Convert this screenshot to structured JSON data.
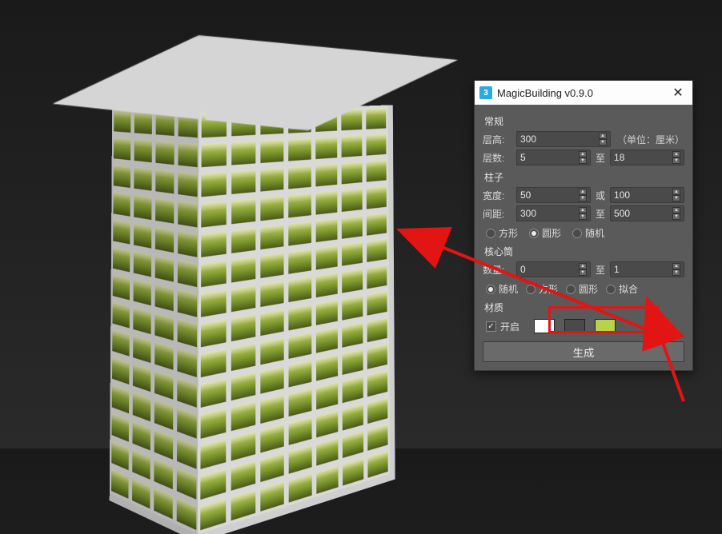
{
  "window": {
    "title": "MagicBuilding v0.9.0"
  },
  "sections": {
    "general": "常规",
    "columns": "柱子",
    "core": "核心筒",
    "material": "材质"
  },
  "labels": {
    "floor_height": "层高:",
    "floor_count": "层数:",
    "width": "宽度:",
    "spacing": "间距:",
    "count": "数量:",
    "unit": "（单位：厘米）",
    "to": "至",
    "or": "或",
    "enable": "开启"
  },
  "values": {
    "floor_height": "300",
    "floors_from": "5",
    "floors_to": "18",
    "col_width_a": "50",
    "col_width_b": "100",
    "col_spacing_a": "300",
    "col_spacing_b": "500",
    "core_from": "0",
    "core_to": "1"
  },
  "radios": {
    "col_square": "方形",
    "col_round": "圆形",
    "col_random": "随机",
    "core_random": "随机",
    "core_square": "方形",
    "core_round": "圆形",
    "core_fit": "拟合"
  },
  "buttons": {
    "generate": "生成"
  },
  "swatches": {
    "c1": "#ffffff",
    "c2": "#4a4a4a",
    "c3": "#b8d24a"
  },
  "icons": {
    "app": "3",
    "close": "✕",
    "check": "✓",
    "up": "▲",
    "down": "▼"
  }
}
